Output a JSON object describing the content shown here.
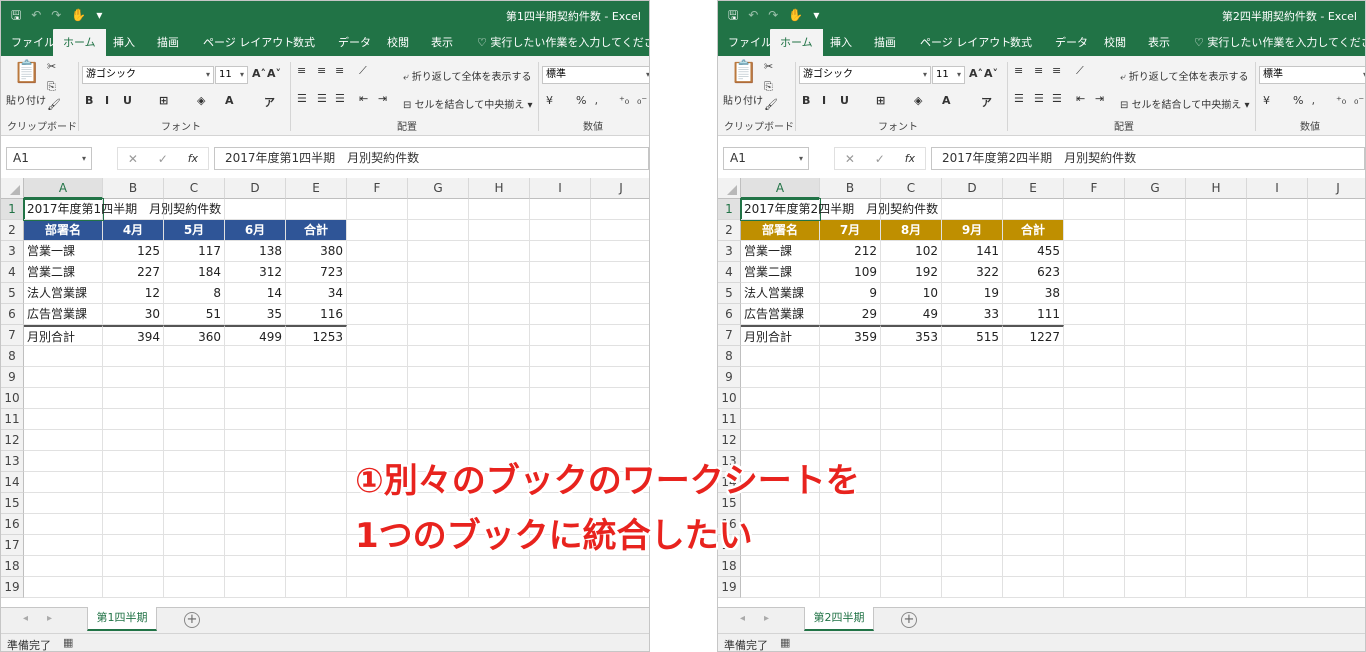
{
  "overlay": {
    "line1": "①別々のブックのワークシートを",
    "line2": "1つのブックに統合したい",
    "color": "#e8231e"
  },
  "ribbon": {
    "tabs": [
      "ファイル",
      "ホーム",
      "挿入",
      "描画",
      "ページ レイアウト",
      "数式",
      "データ",
      "校閲",
      "表示"
    ],
    "active_tab": "ホーム",
    "tell_me": "実行したい作業を入力してください",
    "paste_label": "貼り付け",
    "font_name": "游ゴシック",
    "font_size": "11",
    "wrap_text": "折り返して全体を表示する",
    "merge_center": "セルを結合して中央揃え",
    "number_format": "標準",
    "groups": {
      "clipboard": "クリップボード",
      "font": "フォント",
      "alignment": "配置",
      "number": "数値"
    }
  },
  "columns": [
    "A",
    "B",
    "C",
    "D",
    "E",
    "F",
    "G",
    "H",
    "I",
    "J"
  ],
  "rows": [
    "1",
    "2",
    "3",
    "4",
    "5",
    "6",
    "7",
    "8",
    "9",
    "10",
    "11",
    "12",
    "13",
    "14",
    "15",
    "16",
    "17",
    "18",
    "19"
  ],
  "status": "準備完了",
  "workbooks": [
    {
      "title": "第1四半期契約件数 - Excel",
      "name_box": "A1",
      "formula": "2017年度第1四半期　月別契約件数",
      "sheet_tab": "第1四半期",
      "header_color": "#2f5597",
      "table": {
        "title": "2017年度第1四半期　月別契約件数",
        "headers": [
          "部署名",
          "4月",
          "5月",
          "6月",
          "合計"
        ],
        "rows": [
          [
            "営業一課",
            "125",
            "117",
            "138",
            "380"
          ],
          [
            "営業二課",
            "227",
            "184",
            "312",
            "723"
          ],
          [
            "法人営業課",
            "12",
            "8",
            "14",
            "34"
          ],
          [
            "広告営業課",
            "30",
            "51",
            "35",
            "116"
          ]
        ],
        "total": [
          "月別合計",
          "394",
          "360",
          "499",
          "1253"
        ]
      }
    },
    {
      "title": "第2四半期契約件数 - Excel",
      "name_box": "A1",
      "formula": "2017年度第2四半期　月別契約件数",
      "sheet_tab": "第2四半期",
      "header_color": "#bf8f00",
      "table": {
        "title": "2017年度第2四半期　月別契約件数",
        "headers": [
          "部署名",
          "7月",
          "8月",
          "9月",
          "合計"
        ],
        "rows": [
          [
            "営業一課",
            "212",
            "102",
            "141",
            "455"
          ],
          [
            "営業二課",
            "109",
            "192",
            "322",
            "623"
          ],
          [
            "法人営業課",
            "9",
            "10",
            "19",
            "38"
          ],
          [
            "広告営業課",
            "29",
            "49",
            "33",
            "111"
          ]
        ],
        "total": [
          "月別合計",
          "359",
          "353",
          "515",
          "1227"
        ]
      }
    }
  ]
}
